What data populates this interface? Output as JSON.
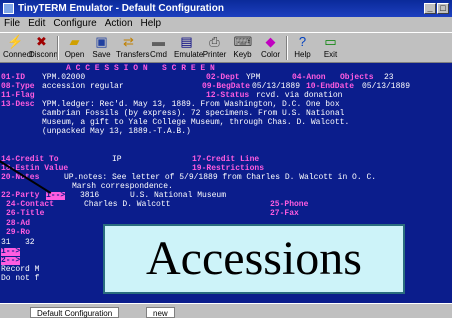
{
  "window": {
    "title": "TinyTERM Emulator - Default Configuration",
    "min_label": "_",
    "max_label": "□"
  },
  "menu": [
    "File",
    "Edit",
    "Configure",
    "Action",
    "Help"
  ],
  "toolbar": {
    "buttons": [
      {
        "label": "Connect",
        "icon": "connect-icon"
      },
      {
        "label": "Disconn",
        "icon": "disconnect-icon"
      },
      {
        "label": "Open",
        "icon": "open-icon"
      },
      {
        "label": "Save",
        "icon": "save-icon"
      },
      {
        "label": "Transfers",
        "icon": "transfer-icon"
      },
      {
        "label": "Cmd",
        "icon": "cmd-icon"
      },
      {
        "label": "Emulate",
        "icon": "emulate-icon"
      },
      {
        "label": "Printer",
        "icon": "printer-icon"
      },
      {
        "label": "Keyb",
        "icon": "keyboard-icon"
      },
      {
        "label": "Color",
        "icon": "color-icon"
      },
      {
        "label": "Help",
        "icon": "help-icon"
      },
      {
        "label": "Exit",
        "icon": "exit-icon"
      }
    ]
  },
  "terminal": {
    "header": "A C C E S S I O N   S C R E E N",
    "id_label": "01-ID",
    "id_value": "YPM.02000",
    "dept_label": "02-Dept",
    "dept_value": "YPM",
    "anon_label": "04-Anon",
    "objects_label": "Objects",
    "objects_value": "23",
    "type_label": "08-Type",
    "type_value": "accession regular",
    "begdate_label": "09-BegDate",
    "begdate_value": "05/13/1889",
    "enddate_label": "10-EndDate",
    "enddate_value": "05/13/1889",
    "flag_label": "11-Flag",
    "status_label": "12-Status",
    "status_value": "rcvd. via donation",
    "desc_label": "13-Desc",
    "desc_lines": [
      "YPM.ledger: Rec'd. May 13, 1889. From Washington, D.C. One box",
      "Cambrian Fossils (by express). 72 specimens. From U.S. National",
      "Museum, a gift to Yale College Museum, through Chas. D. Walcott.",
      "(unpacked May 13, 1889.-T.A.B.)"
    ],
    "credit_to_label": "14-Credit To",
    "credit_to_value": "IP",
    "credit_line_label": "17-Credit Line",
    "estin_label": "18-Estin Value",
    "restrictions_label": "19-Restrictions",
    "notes_label": "20-Notes",
    "notes_lines": [
      "UP.notes: See letter of 5/9/1889 from Charles D. Walcott in O. C.",
      "Marsh correspondence."
    ],
    "party_label": "22-Party",
    "party_arrow": "1-->",
    "party_num": "3816",
    "party_value": "U.S. National Museum",
    "contact_label": "24-Contact",
    "contact_value": "Charles D. Walcott",
    "phone_label": "25-Phone",
    "title_label": "26-Title",
    "fax_label": "27-Fax",
    "ad_label": "28-Ad",
    "ro_label": "29-Ro",
    "row31": "31   32",
    "row_arrow1": "1-->",
    "row_arrow2": "2-->",
    "record_label": "Record M",
    "donot_label": "Do not f"
  },
  "statusbar": {
    "tab1": "Default Configuration",
    "tab2": "new"
  },
  "overlay": {
    "title": "Accessions"
  }
}
